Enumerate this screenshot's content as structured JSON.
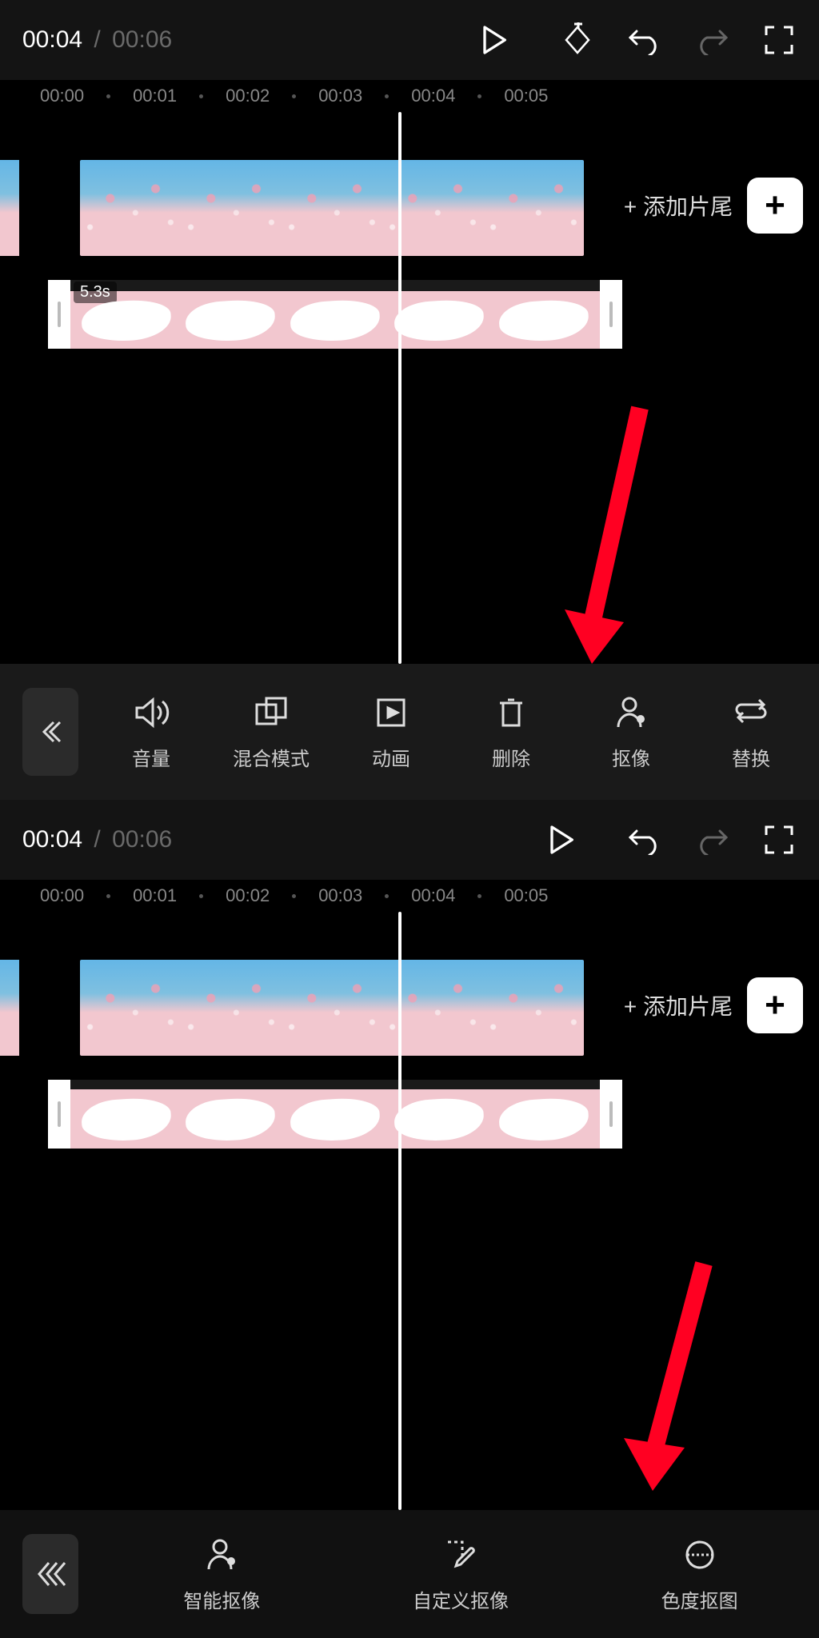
{
  "time": {
    "current": "00:04",
    "sep": "/",
    "total": "00:06"
  },
  "ruler": [
    "00:00",
    "00:01",
    "00:02",
    "00:03",
    "00:04",
    "00:05"
  ],
  "add_ending": "+ 添加片尾",
  "overlay_duration": "5.3s",
  "toolbar": {
    "items": [
      {
        "label": "音量",
        "name": "volume"
      },
      {
        "label": "混合模式",
        "name": "blend-mode"
      },
      {
        "label": "动画",
        "name": "animation"
      },
      {
        "label": "删除",
        "name": "delete"
      },
      {
        "label": "抠像",
        "name": "cutout"
      },
      {
        "label": "替换",
        "name": "replace"
      }
    ]
  },
  "submenu": {
    "items": [
      {
        "label": "智能抠像",
        "name": "smart-cutout"
      },
      {
        "label": "自定义抠像",
        "name": "custom-cutout"
      },
      {
        "label": "色度抠图",
        "name": "chroma-key"
      }
    ]
  }
}
